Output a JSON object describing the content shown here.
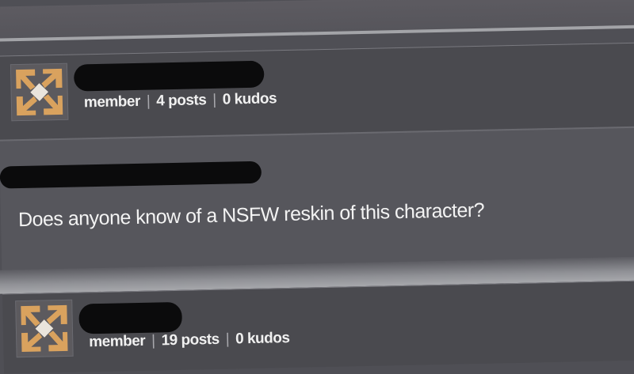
{
  "posts": [
    {
      "role": "member",
      "posts": "4 posts",
      "kudos": "0 kudos",
      "body": "Does anyone know of a NSFW reskin of this character?"
    },
    {
      "role": "member",
      "posts": "19 posts",
      "kudos": "0 kudos"
    }
  ],
  "colors": {
    "header_bg": "#4a4a4f",
    "body_bg": "#56565c",
    "text": "#f3f3f3",
    "redaction": "#0b0b0c",
    "avatar_orange": "#d9a25e"
  }
}
